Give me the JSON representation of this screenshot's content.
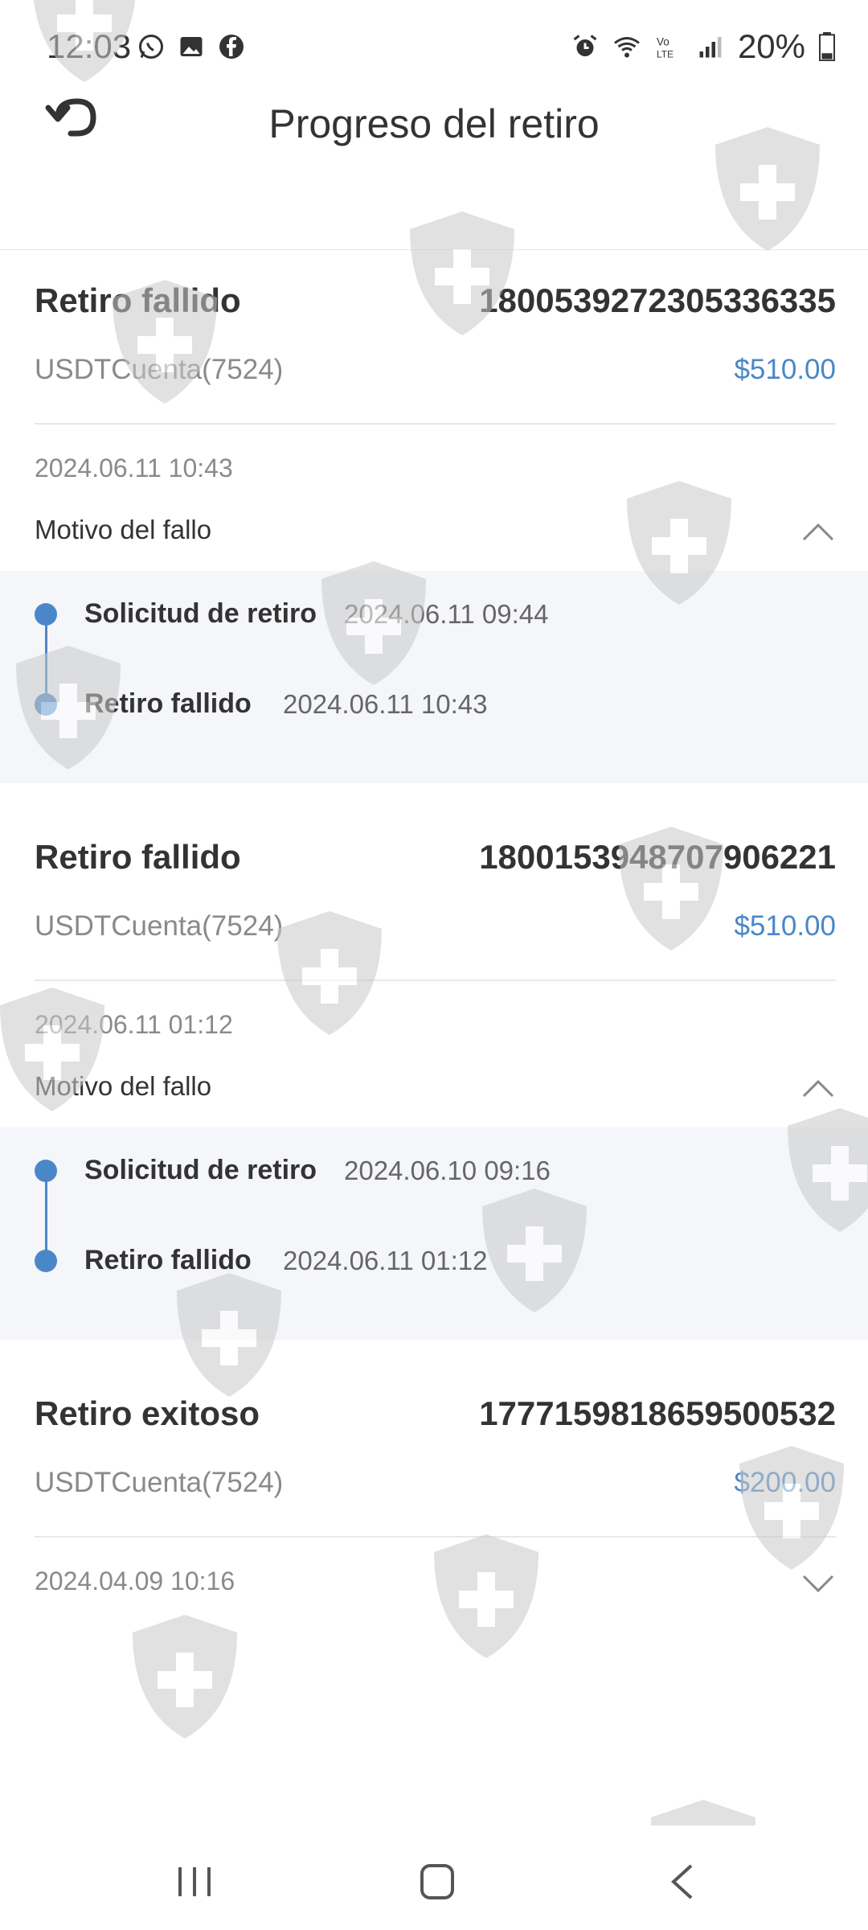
{
  "status_bar": {
    "time": "12:03",
    "notification_icons": [
      "whatsapp-icon",
      "gallery-icon",
      "facebook-icon"
    ],
    "right_icons": [
      "alarm-icon",
      "wifi-icon",
      "volte-icon",
      "signal-icon"
    ],
    "battery": "20%"
  },
  "header": {
    "title": "Progreso del retiro"
  },
  "records": [
    {
      "status": "Retiro fallido",
      "order_id": "1800539272305336335",
      "account": "USDTCuenta(7524)",
      "amount": "$510.00",
      "date": "2024.06.11 10:43",
      "reason_label": "Motivo del fallo",
      "expanded": true,
      "timeline": [
        {
          "label": "Solicitud de retiro",
          "time": "2024.06.11 09:44"
        },
        {
          "label": "Retiro fallido",
          "time": "2024.06.11 10:43"
        }
      ]
    },
    {
      "status": "Retiro fallido",
      "order_id": "1800153948707906221",
      "account": "USDTCuenta(7524)",
      "amount": "$510.00",
      "date": "2024.06.11 01:12",
      "reason_label": "Motivo del fallo",
      "expanded": true,
      "timeline": [
        {
          "label": "Solicitud de retiro",
          "time": "2024.06.10 09:16"
        },
        {
          "label": "Retiro fallido",
          "time": "2024.06.11 01:12"
        }
      ]
    },
    {
      "status": "Retiro exitoso",
      "order_id": "1777159818659500532",
      "account": "USDTCuenta(7524)",
      "amount": "$200.00",
      "date": "2024.04.09 10:16",
      "expanded": false
    }
  ],
  "colors": {
    "accent": "#4a87c8",
    "timeline_bg": "#f5f6fa",
    "muted_text": "#8a8a8a"
  },
  "nav": [
    "recent-apps-icon",
    "home-icon",
    "back-icon"
  ]
}
